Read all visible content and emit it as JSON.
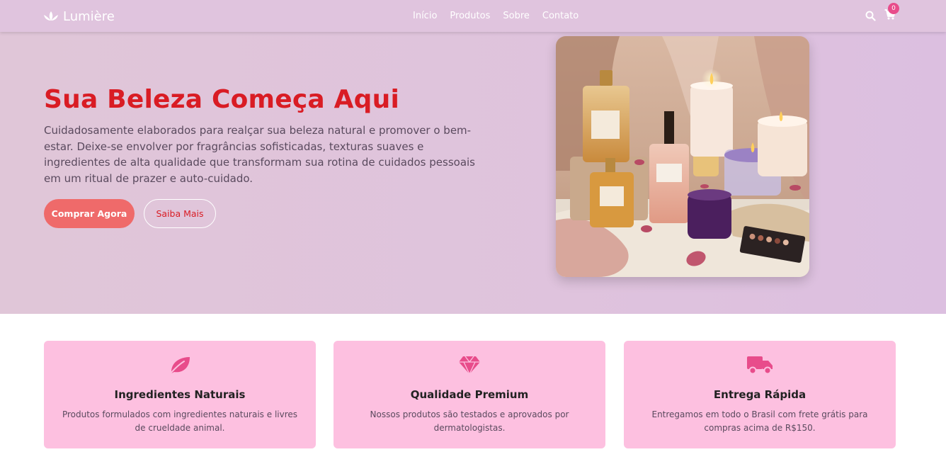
{
  "brand": {
    "name": "Lumière",
    "icon": "lotus-icon"
  },
  "nav": {
    "links": [
      "Início",
      "Produtos",
      "Sobre",
      "Contato"
    ],
    "cart_count": "0"
  },
  "hero": {
    "title": "Sua Beleza Começa Aqui",
    "description": "Cuidadosamente elaborados para realçar sua beleza natural e promover o bem-estar. Deixe-se envolver por fragrâncias sofisticadas, texturas suaves e ingredientes de alta qualidade que transformam sua rotina de cuidados pessoais em um ritual de prazer e auto-cuidado.",
    "primary_button": "Comprar Agora",
    "secondary_button": "Saiba Mais"
  },
  "features": [
    {
      "icon": "leaf-icon",
      "title": "Ingredientes Naturais",
      "text": "Produtos formulados com ingredientes naturais e livres de crueldade animal."
    },
    {
      "icon": "gem-icon",
      "title": "Qualidade Premium",
      "text": "Nossos produtos são testados e aprovados por dermatologistas."
    },
    {
      "icon": "truck-icon",
      "title": "Entrega Rápida",
      "text": "Entregamos em todo o Brasil com frete grátis para compras acima de R$150."
    }
  ],
  "colors": {
    "accent": "#d91c24",
    "button": "#ef6a6a",
    "icon": "#e84c8b",
    "card": "#fdc0e0"
  }
}
